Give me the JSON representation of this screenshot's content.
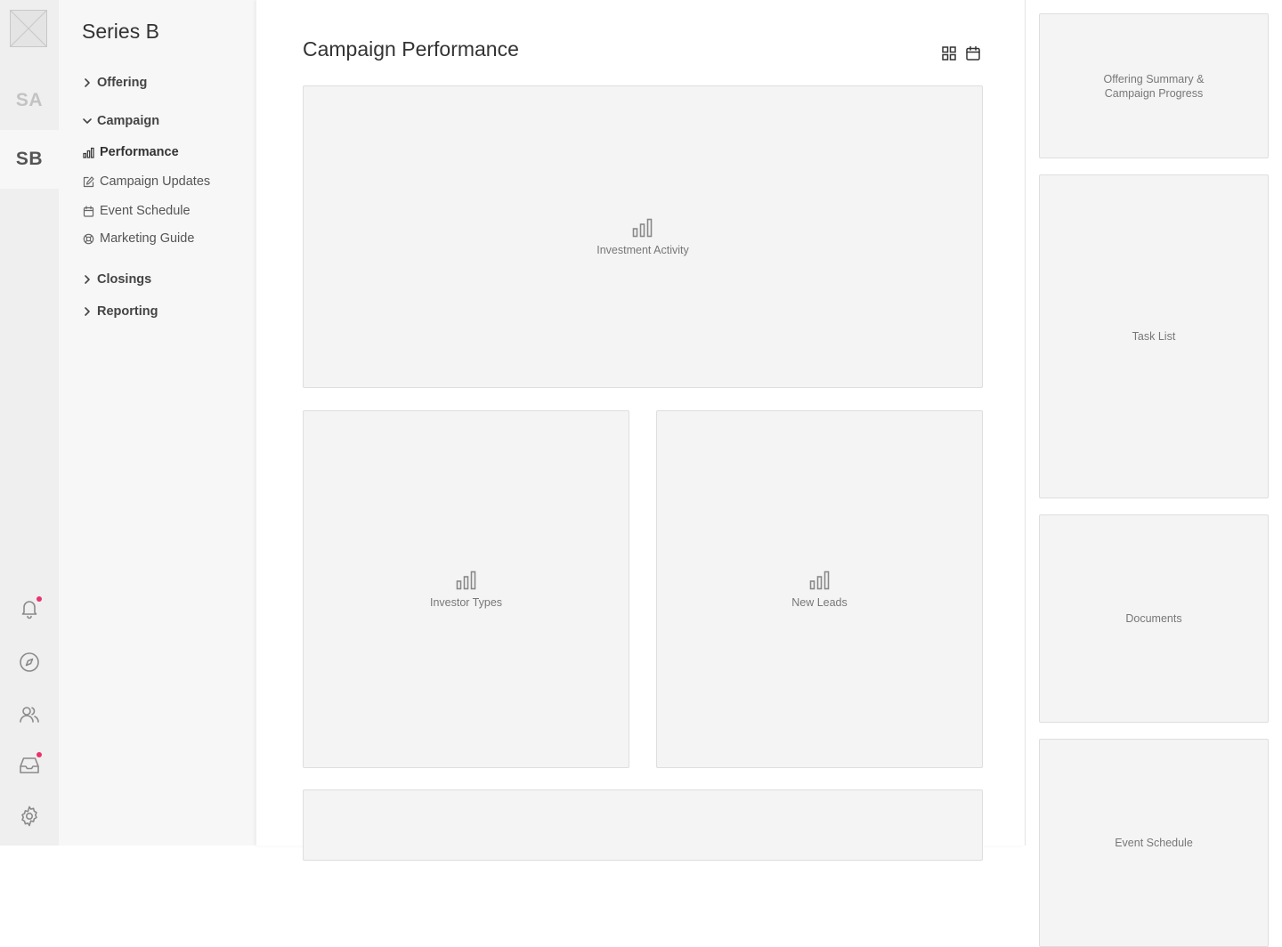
{
  "rail": {
    "workspaces": [
      {
        "initials": "SA"
      },
      {
        "initials": "SB"
      }
    ],
    "icons": [
      "bell-icon",
      "compass-icon",
      "users-icon",
      "inbox-icon",
      "gear-icon"
    ],
    "notification_color": "#e8336d"
  },
  "sidebar": {
    "project_title": "Series B",
    "groups": [
      {
        "label": "Offering",
        "expanded": false
      },
      {
        "label": "Campaign",
        "expanded": true,
        "items": [
          {
            "label": "Performance",
            "icon": "bar-chart-icon",
            "active": true
          },
          {
            "label": "Campaign Updates",
            "icon": "edit-icon"
          },
          {
            "label": "Event Schedule",
            "icon": "calendar-icon"
          },
          {
            "label": "Marketing Guide",
            "icon": "lifebuoy-icon"
          }
        ]
      },
      {
        "label": "Closings",
        "expanded": false
      },
      {
        "label": "Reporting",
        "expanded": false
      }
    ]
  },
  "main": {
    "title": "Campaign Performance",
    "toolbar": [
      "grid-view-icon",
      "calendar-icon"
    ],
    "cards": [
      {
        "label": "Investment Activity"
      },
      {
        "label": "Investor Types"
      },
      {
        "label": "New Leads"
      },
      {
        "label": ""
      }
    ]
  },
  "right_panel": {
    "cards": [
      {
        "label": "Offering Summary & Campaign Progress"
      },
      {
        "label": "Task List"
      },
      {
        "label": "Documents"
      },
      {
        "label": "Event Schedule"
      }
    ]
  }
}
